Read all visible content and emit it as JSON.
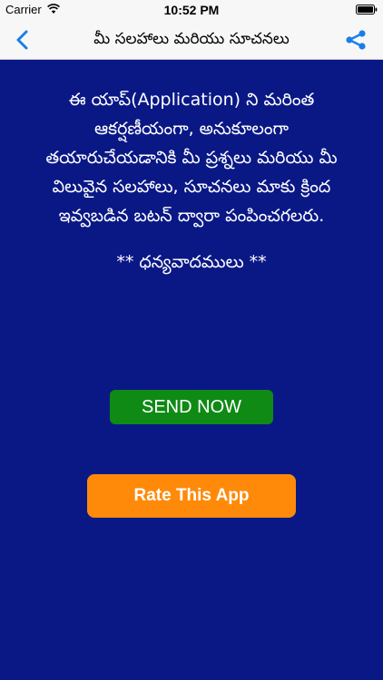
{
  "status_bar": {
    "carrier": "Carrier",
    "time": "10:52 PM",
    "icons": [
      "wifi-icon",
      "battery-icon"
    ]
  },
  "nav_bar": {
    "title": "మీ సలహాలు మరియు సూచనలు",
    "back_icon": "chevron-left-icon",
    "share_icon": "share-icon",
    "accent_color": "#1a7ee6"
  },
  "main": {
    "message_lines": [
      "ఈ యాప్(Application) ని మరింత",
      "ఆకర్షణీయంగా, అనుకూలంగా",
      "తయారుచేయడానికి మీ ప్రశ్నలు మరియు మీ",
      "విలువైన సలహాలు, సూచనలు మాకు క్రింద",
      "ఇవ్వబడిన బటన్ ద్వారా పంపించగలరు."
    ],
    "thanks": "** ధన్యవాదములు **",
    "send_button": "SEND NOW",
    "rate_button": "Rate This App",
    "background_color": "#0a1886",
    "send_color": "#0f8a15",
    "rate_color": "#ff8a0a"
  }
}
